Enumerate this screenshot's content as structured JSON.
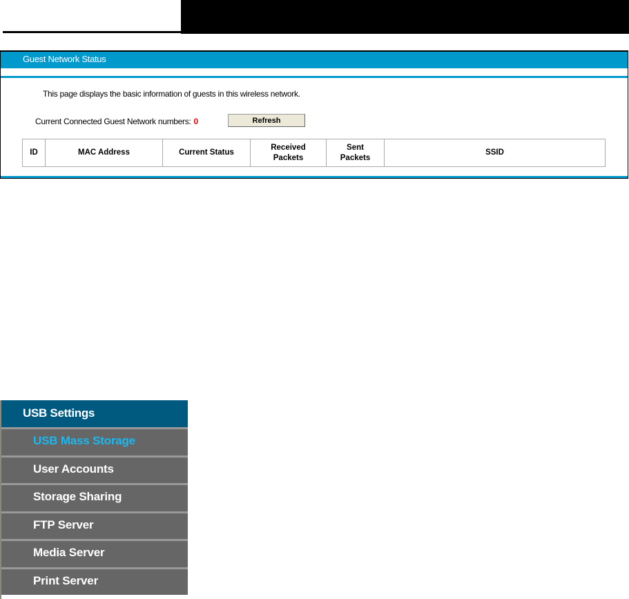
{
  "panel": {
    "title": "Guest Network Status",
    "description": "This page displays the basic information of guests in this wireless network.",
    "count_label": "Current Connected Guest Network numbers:",
    "count_value": "0",
    "refresh_label": "Refresh",
    "table_headers": [
      "ID",
      "MAC Address",
      "Current Status",
      "Received Packets",
      "Sent Packets",
      "SSID"
    ]
  },
  "sidebar": {
    "header": "USB Settings",
    "items": [
      {
        "label": "USB Mass Storage",
        "active": true
      },
      {
        "label": "User Accounts"
      },
      {
        "label": "Storage Sharing"
      },
      {
        "label": "FTP Server"
      },
      {
        "label": "Media Server"
      },
      {
        "label": "Print Server"
      }
    ]
  },
  "colors": {
    "accent": "#0099cc",
    "sidebar_header": "#005a80",
    "active_item": "#1ab8f0",
    "count": "#ee0000"
  }
}
